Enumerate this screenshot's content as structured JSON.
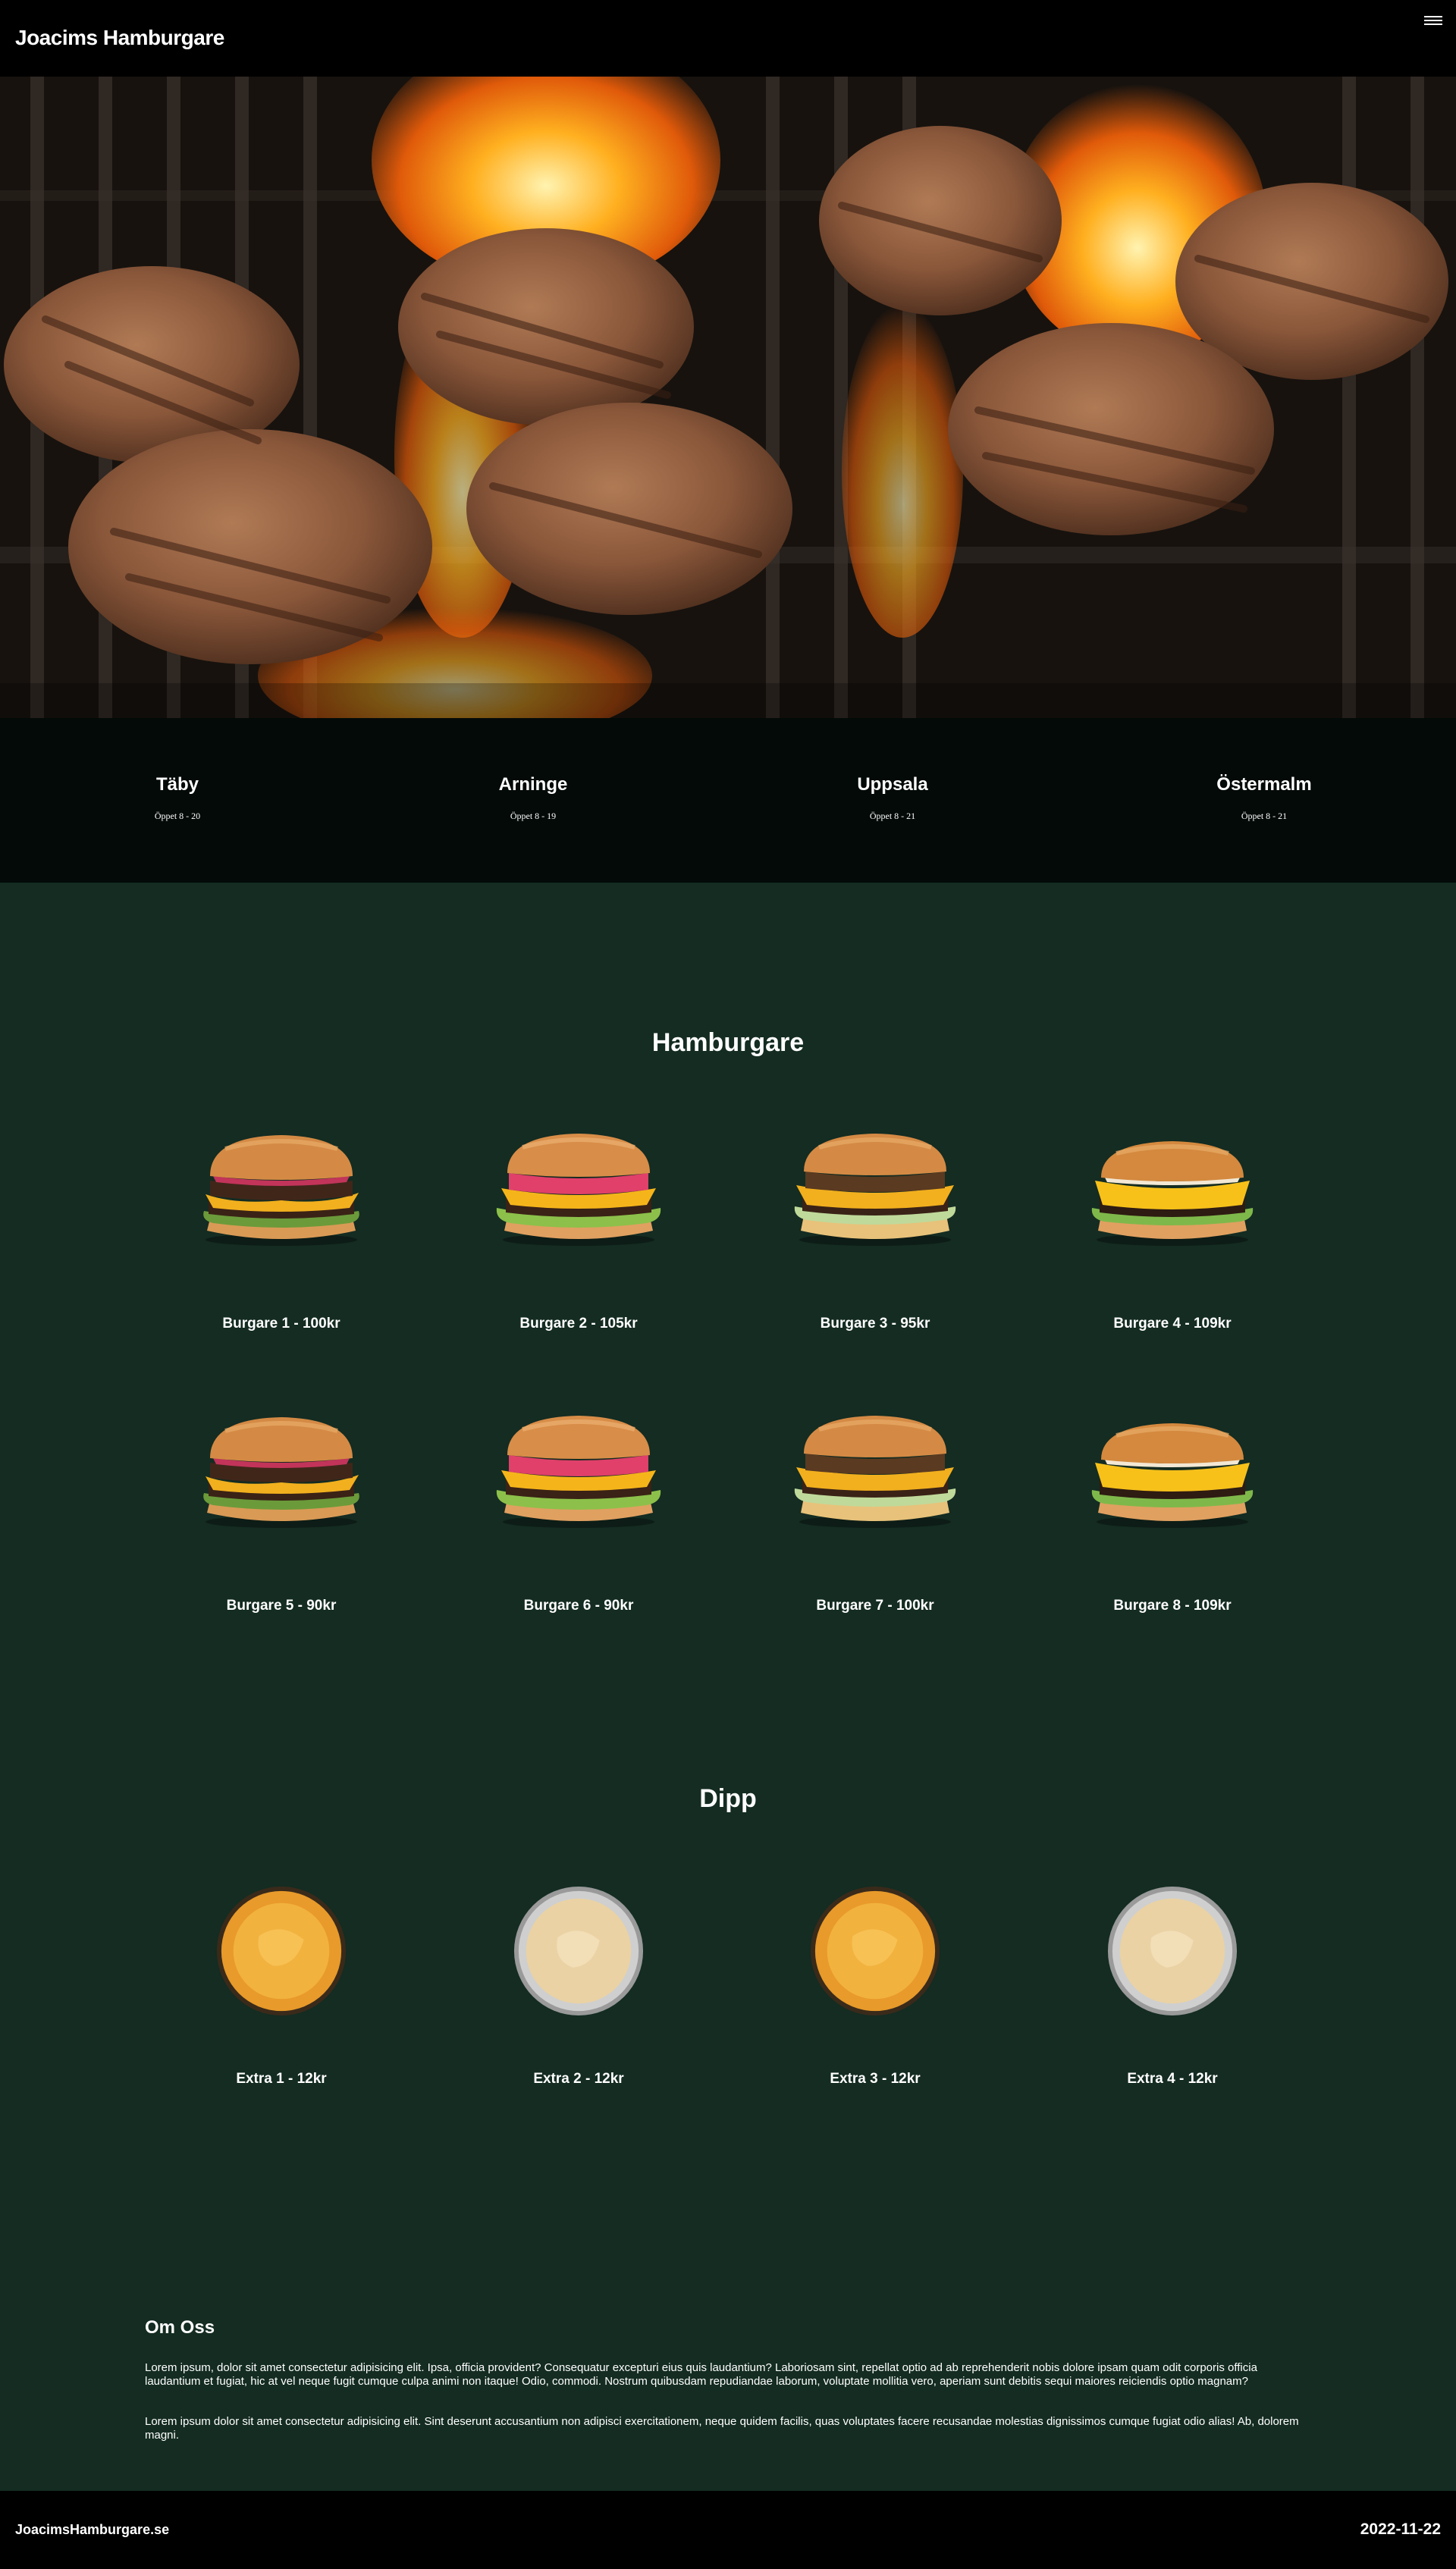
{
  "header": {
    "brand": "Joacims Hamburgare",
    "menu_icon": "hamburger-menu-icon"
  },
  "locations": [
    {
      "name": "Täby",
      "hours": "Öppet 8 - 20"
    },
    {
      "name": "Arninge",
      "hours": "Öppet 8 - 19"
    },
    {
      "name": "Uppsala",
      "hours": "Öppet 8 - 21"
    },
    {
      "name": "Östermalm",
      "hours": "Öppet 8 - 21"
    }
  ],
  "burgers": {
    "title": "Hamburgare",
    "items": [
      {
        "label": "Burgare 1 - 100kr"
      },
      {
        "label": "Burgare 2 - 105kr"
      },
      {
        "label": "Burgare 3 - 95kr"
      },
      {
        "label": "Burgare 4 - 109kr"
      },
      {
        "label": "Burgare 5 - 90kr"
      },
      {
        "label": "Burgare 6 - 90kr"
      },
      {
        "label": "Burgare 7 - 100kr"
      },
      {
        "label": "Burgare 8 - 109kr"
      }
    ]
  },
  "dips": {
    "title": "Dipp",
    "items": [
      {
        "label": "Extra 1 - 12kr"
      },
      {
        "label": "Extra 2 - 12kr"
      },
      {
        "label": "Extra 3 - 12kr"
      },
      {
        "label": "Extra 4 - 12kr"
      }
    ]
  },
  "about": {
    "title": "Om Oss",
    "paragraphs": [
      "Lorem ipsum, dolor sit amet consectetur adipisicing elit. Ipsa, officia provident? Consequatur excepturi eius quis laudantium? Laboriosam sint, repellat optio ad ab reprehenderit nobis dolore ipsam quam odit corporis officia laudantium et fugiat, hic at vel neque fugit cumque culpa animi non itaque! Odio, commodi. Nostrum quibusdam repudiandae laborum, voluptate mollitia vero, aperiam sunt debitis sequi maiores reiciendis optio magnam?",
      "Lorem ipsum dolor sit amet consectetur adipisicing elit. Sint deserunt accusantium non adipisci exercitationem, neque quidem facilis, quas voluptates facere recusandae molestias dignissimos cumque fugiat odio alias! Ab, dolorem magni."
    ]
  },
  "footer": {
    "site": "JoacimsHamburgare.se",
    "date": "2022-11-22"
  },
  "colors": {
    "header_bg": "#000000",
    "locations_bg": "#030a08",
    "main_bg": "#142c22",
    "text": "#ffffff"
  }
}
